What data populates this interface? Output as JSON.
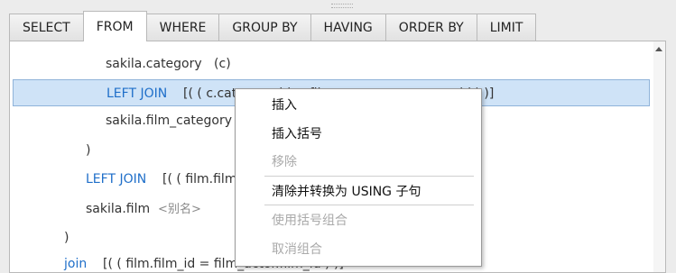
{
  "tabs": [
    {
      "label": "SELECT"
    },
    {
      "label": "FROM",
      "active": true
    },
    {
      "label": "WHERE"
    },
    {
      "label": "GROUP BY"
    },
    {
      "label": "HAVING"
    },
    {
      "label": "ORDER BY"
    },
    {
      "label": "LIMIT"
    }
  ],
  "editor": {
    "l1_table": "sakila.category",
    "l1_alias": "(c)",
    "l2_join": "LEFT JOIN",
    "l2_cond": "[( ( c.category_id = film_category.category_id ) )]",
    "l3_table": "sakila.film_category",
    "l4_paren": ")",
    "l5_join": "LEFT JOIN",
    "l5_cond": "[( ( film.film_id = film_category.film_id ) )]",
    "l6_table": "sakila.film",
    "l6_alias_placeholder": "<别名>",
    "l7_paren": ")",
    "l8_join": "join",
    "l8_cond": "[( ( film.film_id = film_actor.film_id ) )]"
  },
  "context_menu": {
    "insert": "插入",
    "insert_parens": "插入括号",
    "remove": "移除",
    "clear_convert_using": "清除并转换为 USING 子句",
    "use_parens_group": "使用括号组合",
    "ungroup": "取消组合"
  }
}
